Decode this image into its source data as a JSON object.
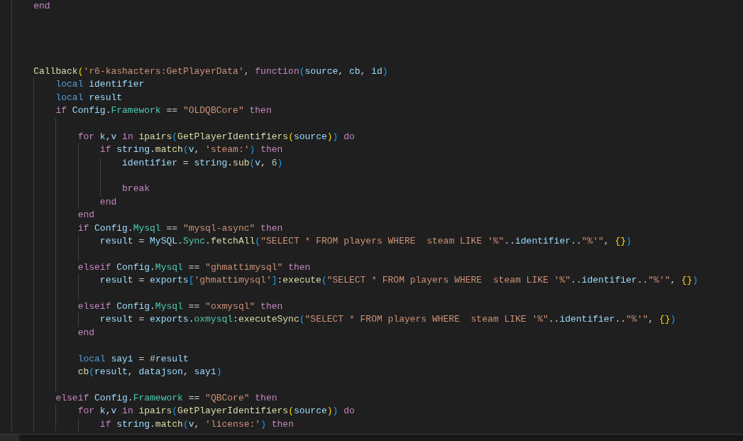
{
  "editor": {
    "lines": [
      {
        "kind": "code",
        "tokens": [
          {
            "text": "    end",
            "kind": "kw"
          }
        ]
      },
      {
        "kind": "blank"
      },
      {
        "kind": "blank"
      },
      {
        "kind": "blank"
      },
      {
        "kind": "blank"
      },
      {
        "kind": "code",
        "tokens": [
          {
            "text": "    Callback",
            "kind": "fn"
          },
          {
            "text": "(",
            "kind": "p1"
          },
          {
            "text": "'r6-kashacters:GetPlayerData'",
            "kind": "str"
          },
          {
            "text": ", ",
            "kind": "op"
          },
          {
            "text": "function",
            "kind": "kw"
          },
          {
            "text": "(",
            "kind": "p2"
          },
          {
            "text": "source",
            "kind": "var"
          },
          {
            "text": ", ",
            "kind": "op"
          },
          {
            "text": "cb",
            "kind": "var"
          },
          {
            "text": ", ",
            "kind": "op"
          },
          {
            "text": "id",
            "kind": "var"
          },
          {
            "text": ")",
            "kind": "p2"
          }
        ]
      },
      {
        "kind": "code",
        "tokens": [
          {
            "text": "        local ",
            "kind": "storage"
          },
          {
            "text": "identifier",
            "kind": "var"
          }
        ]
      },
      {
        "kind": "code",
        "tokens": [
          {
            "text": "        local ",
            "kind": "storage"
          },
          {
            "text": "result",
            "kind": "var"
          }
        ]
      },
      {
        "kind": "code",
        "tokens": [
          {
            "text": "        if ",
            "kind": "kw"
          },
          {
            "text": "Config",
            "kind": "var"
          },
          {
            "text": ".",
            "kind": "op"
          },
          {
            "text": "Framework",
            "kind": "prop"
          },
          {
            "text": " == ",
            "kind": "op"
          },
          {
            "text": "\"OLDQBCore\" ",
            "kind": "str"
          },
          {
            "text": "then",
            "kind": "kw"
          }
        ]
      },
      {
        "kind": "blank"
      },
      {
        "kind": "code",
        "tokens": [
          {
            "text": "            for ",
            "kind": "kw"
          },
          {
            "text": "k",
            "kind": "var"
          },
          {
            "text": ",",
            "kind": "op"
          },
          {
            "text": "v ",
            "kind": "var"
          },
          {
            "text": "in ",
            "kind": "kw"
          },
          {
            "text": "ipairs",
            "kind": "fn"
          },
          {
            "text": "(",
            "kind": "p2"
          },
          {
            "text": "GetPlayerIdentifiers",
            "kind": "fn"
          },
          {
            "text": "(",
            "kind": "p1"
          },
          {
            "text": "source",
            "kind": "var"
          },
          {
            "text": ")",
            "kind": "p1"
          },
          {
            "text": ") ",
            "kind": "p2"
          },
          {
            "text": "do",
            "kind": "kw"
          }
        ]
      },
      {
        "kind": "code",
        "tokens": [
          {
            "text": "                if ",
            "kind": "kw"
          },
          {
            "text": "string",
            "kind": "var"
          },
          {
            "text": ".",
            "kind": "op"
          },
          {
            "text": "match",
            "kind": "fn"
          },
          {
            "text": "(",
            "kind": "p2"
          },
          {
            "text": "v",
            "kind": "var"
          },
          {
            "text": ", ",
            "kind": "op"
          },
          {
            "text": "'steam:'",
            "kind": "str"
          },
          {
            "text": ") ",
            "kind": "p2"
          },
          {
            "text": "then",
            "kind": "kw"
          }
        ]
      },
      {
        "kind": "code",
        "tokens": [
          {
            "text": "                    identifier",
            "kind": "var"
          },
          {
            "text": " = ",
            "kind": "op"
          },
          {
            "text": "string",
            "kind": "var"
          },
          {
            "text": ".",
            "kind": "op"
          },
          {
            "text": "sub",
            "kind": "fn"
          },
          {
            "text": "(",
            "kind": "p2"
          },
          {
            "text": "v",
            "kind": "var"
          },
          {
            "text": ", ",
            "kind": "op"
          },
          {
            "text": "6",
            "kind": "num"
          },
          {
            "text": ")",
            "kind": "p2"
          }
        ]
      },
      {
        "kind": "blank"
      },
      {
        "kind": "code",
        "tokens": [
          {
            "text": "                    break",
            "kind": "kw"
          }
        ]
      },
      {
        "kind": "code",
        "tokens": [
          {
            "text": "                end",
            "kind": "kw"
          }
        ]
      },
      {
        "kind": "code",
        "tokens": [
          {
            "text": "            end",
            "kind": "kw"
          }
        ]
      },
      {
        "kind": "code",
        "tokens": [
          {
            "text": "            if ",
            "kind": "kw"
          },
          {
            "text": "Config",
            "kind": "var"
          },
          {
            "text": ".",
            "kind": "op"
          },
          {
            "text": "Mysql",
            "kind": "prop"
          },
          {
            "text": " == ",
            "kind": "op"
          },
          {
            "text": "\"mysql-async\" ",
            "kind": "str"
          },
          {
            "text": "then",
            "kind": "kw"
          }
        ]
      },
      {
        "kind": "code",
        "tokens": [
          {
            "text": "                result",
            "kind": "var"
          },
          {
            "text": " = ",
            "kind": "op"
          },
          {
            "text": "MySQL",
            "kind": "var"
          },
          {
            "text": ".",
            "kind": "op"
          },
          {
            "text": "Sync",
            "kind": "prop"
          },
          {
            "text": ".",
            "kind": "op"
          },
          {
            "text": "fetchAll",
            "kind": "fn"
          },
          {
            "text": "(",
            "kind": "p2"
          },
          {
            "text": "\"SELECT * FROM players WHERE  steam LIKE '%\"",
            "kind": "str"
          },
          {
            "text": "..",
            "kind": "op"
          },
          {
            "text": "identifier",
            "kind": "var"
          },
          {
            "text": "..",
            "kind": "op"
          },
          {
            "text": "\"%'\"",
            "kind": "str"
          },
          {
            "text": ", ",
            "kind": "op"
          },
          {
            "text": "{}",
            "kind": "p1"
          },
          {
            "text": ")",
            "kind": "p2"
          }
        ]
      },
      {
        "kind": "blank"
      },
      {
        "kind": "code",
        "tokens": [
          {
            "text": "            elseif ",
            "kind": "kw"
          },
          {
            "text": "Config",
            "kind": "var"
          },
          {
            "text": ".",
            "kind": "op"
          },
          {
            "text": "Mysql",
            "kind": "prop"
          },
          {
            "text": " == ",
            "kind": "op"
          },
          {
            "text": "\"ghmattimysql\" ",
            "kind": "str"
          },
          {
            "text": "then",
            "kind": "kw"
          }
        ]
      },
      {
        "kind": "code",
        "tokens": [
          {
            "text": "                result",
            "kind": "var"
          },
          {
            "text": " = ",
            "kind": "op"
          },
          {
            "text": "exports",
            "kind": "var"
          },
          {
            "text": "[",
            "kind": "p2"
          },
          {
            "text": "'ghmattimysql'",
            "kind": "str"
          },
          {
            "text": "]",
            "kind": "p2"
          },
          {
            "text": ":",
            "kind": "op"
          },
          {
            "text": "execute",
            "kind": "fn"
          },
          {
            "text": "(",
            "kind": "p2"
          },
          {
            "text": "\"SELECT * FROM players WHERE  steam LIKE '%\"",
            "kind": "str"
          },
          {
            "text": "..",
            "kind": "op"
          },
          {
            "text": "identifier",
            "kind": "var"
          },
          {
            "text": "..",
            "kind": "op"
          },
          {
            "text": "\"%'\"",
            "kind": "str"
          },
          {
            "text": ", ",
            "kind": "op"
          },
          {
            "text": "{}",
            "kind": "p1"
          },
          {
            "text": ")",
            "kind": "p2"
          }
        ]
      },
      {
        "kind": "blank"
      },
      {
        "kind": "code",
        "tokens": [
          {
            "text": "            elseif ",
            "kind": "kw"
          },
          {
            "text": "Config",
            "kind": "var"
          },
          {
            "text": ".",
            "kind": "op"
          },
          {
            "text": "Mysql",
            "kind": "prop"
          },
          {
            "text": " == ",
            "kind": "op"
          },
          {
            "text": "\"oxmysql\" ",
            "kind": "str"
          },
          {
            "text": "then",
            "kind": "kw"
          }
        ]
      },
      {
        "kind": "code",
        "tokens": [
          {
            "text": "                result",
            "kind": "var"
          },
          {
            "text": " = ",
            "kind": "op"
          },
          {
            "text": "exports",
            "kind": "var"
          },
          {
            "text": ".",
            "kind": "op"
          },
          {
            "text": "oxmysql",
            "kind": "prop"
          },
          {
            "text": ":",
            "kind": "op"
          },
          {
            "text": "executeSync",
            "kind": "fn"
          },
          {
            "text": "(",
            "kind": "p2"
          },
          {
            "text": "\"SELECT * FROM players WHERE  steam LIKE '%\"",
            "kind": "str"
          },
          {
            "text": "..",
            "kind": "op"
          },
          {
            "text": "identifier",
            "kind": "var"
          },
          {
            "text": "..",
            "kind": "op"
          },
          {
            "text": "\"%'\"",
            "kind": "str"
          },
          {
            "text": ", ",
            "kind": "op"
          },
          {
            "text": "{}",
            "kind": "p1"
          },
          {
            "text": ")",
            "kind": "p2"
          }
        ]
      },
      {
        "kind": "code",
        "tokens": [
          {
            "text": "            end",
            "kind": "kw"
          }
        ]
      },
      {
        "kind": "blank"
      },
      {
        "kind": "code",
        "tokens": [
          {
            "text": "            local ",
            "kind": "storage"
          },
          {
            "text": "sayi",
            "kind": "var"
          },
          {
            "text": " = #",
            "kind": "op"
          },
          {
            "text": "result",
            "kind": "var"
          }
        ]
      },
      {
        "kind": "code",
        "tokens": [
          {
            "text": "            cb",
            "kind": "fn"
          },
          {
            "text": "(",
            "kind": "p2"
          },
          {
            "text": "result",
            "kind": "var"
          },
          {
            "text": ", ",
            "kind": "op"
          },
          {
            "text": "datajson",
            "kind": "var"
          },
          {
            "text": ", ",
            "kind": "op"
          },
          {
            "text": "sayi",
            "kind": "var"
          },
          {
            "text": ")",
            "kind": "p2"
          }
        ]
      },
      {
        "kind": "blank"
      },
      {
        "kind": "code",
        "tokens": [
          {
            "text": "        elseif ",
            "kind": "kw"
          },
          {
            "text": "Config",
            "kind": "var"
          },
          {
            "text": ".",
            "kind": "op"
          },
          {
            "text": "Framework",
            "kind": "prop"
          },
          {
            "text": " == ",
            "kind": "op"
          },
          {
            "text": "\"QBCore\" ",
            "kind": "str"
          },
          {
            "text": "then",
            "kind": "kw"
          }
        ]
      },
      {
        "kind": "code",
        "tokens": [
          {
            "text": "            for ",
            "kind": "kw"
          },
          {
            "text": "k",
            "kind": "var"
          },
          {
            "text": ",",
            "kind": "op"
          },
          {
            "text": "v ",
            "kind": "var"
          },
          {
            "text": "in ",
            "kind": "kw"
          },
          {
            "text": "ipairs",
            "kind": "fn"
          },
          {
            "text": "(",
            "kind": "p2"
          },
          {
            "text": "GetPlayerIdentifiers",
            "kind": "fn"
          },
          {
            "text": "(",
            "kind": "p1"
          },
          {
            "text": "source",
            "kind": "var"
          },
          {
            "text": ")",
            "kind": "p1"
          },
          {
            "text": ") ",
            "kind": "p2"
          },
          {
            "text": "do",
            "kind": "kw"
          }
        ]
      },
      {
        "kind": "code",
        "tokens": [
          {
            "text": "                if ",
            "kind": "kw"
          },
          {
            "text": "string",
            "kind": "var"
          },
          {
            "text": ".",
            "kind": "op"
          },
          {
            "text": "match",
            "kind": "fn"
          },
          {
            "text": "(",
            "kind": "p2"
          },
          {
            "text": "v",
            "kind": "var"
          },
          {
            "text": ", ",
            "kind": "op"
          },
          {
            "text": "'license:'",
            "kind": "str"
          },
          {
            "text": ") ",
            "kind": "p2"
          },
          {
            "text": "then",
            "kind": "kw"
          }
        ]
      }
    ]
  }
}
